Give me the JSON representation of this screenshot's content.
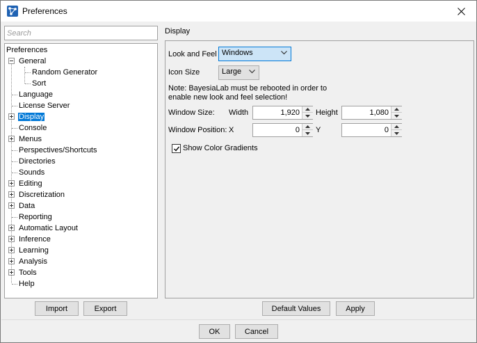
{
  "window": {
    "title": "Preferences",
    "app_icon": "bayesialab-network-icon",
    "close_icon": "close-icon"
  },
  "search": {
    "placeholder": "Search",
    "value": ""
  },
  "tree": {
    "root": "Preferences",
    "items": [
      {
        "label": "General",
        "expandable": true,
        "expanded": true
      },
      {
        "label": "Random Generator",
        "child": true
      },
      {
        "label": "Sort",
        "child": true
      },
      {
        "label": "Language"
      },
      {
        "label": "License Server"
      },
      {
        "label": "Display",
        "expandable": true,
        "selected": true
      },
      {
        "label": "Console"
      },
      {
        "label": "Menus",
        "expandable": true
      },
      {
        "label": "Perspectives/Shortcuts"
      },
      {
        "label": "Directories"
      },
      {
        "label": "Sounds"
      },
      {
        "label": "Editing",
        "expandable": true
      },
      {
        "label": "Discretization",
        "expandable": true
      },
      {
        "label": "Data",
        "expandable": true
      },
      {
        "label": "Reporting"
      },
      {
        "label": "Automatic Layout",
        "expandable": true
      },
      {
        "label": "Inference",
        "expandable": true
      },
      {
        "label": "Learning",
        "expandable": true
      },
      {
        "label": "Analysis",
        "expandable": true
      },
      {
        "label": "Tools",
        "expandable": true
      },
      {
        "label": "Help"
      }
    ]
  },
  "left_buttons": {
    "import": "Import",
    "export": "Export"
  },
  "display": {
    "section_title": "Display",
    "look_and_feel_label": "Look and Feel",
    "look_and_feel_value": "Windows",
    "icon_size_label": "Icon Size",
    "icon_size_value": "Large",
    "note_line1": "Note: BayesiaLab must be rebooted in order to",
    "note_line2": "enable new look and feel selection!",
    "window_size_label": "Window Size:",
    "width_label": "Width",
    "width_value": "1,920",
    "height_label": "Height",
    "height_value": "1,080",
    "window_position_label": "Window Position:",
    "x_label": "X",
    "x_value": "0",
    "y_label": "Y",
    "y_value": "0",
    "show_gradients_label": "Show Color Gradients",
    "show_gradients_checked": true,
    "default_values_button": "Default Values",
    "apply_button": "Apply"
  },
  "footer": {
    "ok": "OK",
    "cancel": "Cancel"
  },
  "colors": {
    "selection": "#0078d7",
    "focus_fill": "#cce4f7"
  }
}
